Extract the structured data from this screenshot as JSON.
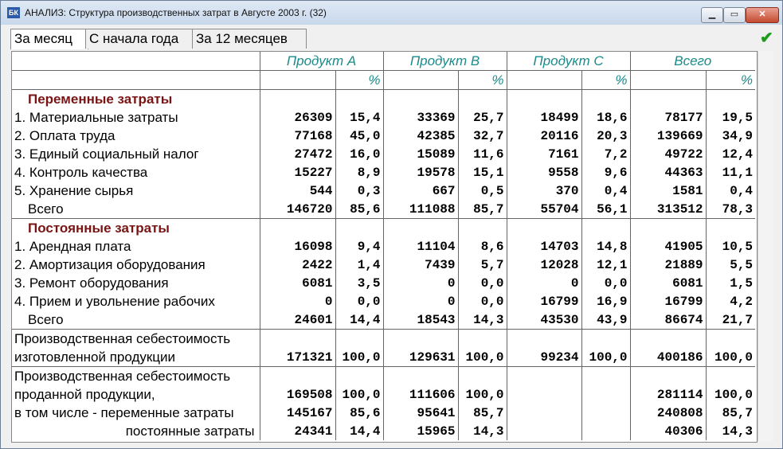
{
  "window": {
    "title": "АНАЛИЗ: Структура производственных затрат в Августе 2003 г. (32)",
    "icon_text": "БК",
    "min_label": "▁",
    "max_label": "▭",
    "close_label": "✕"
  },
  "tabs": [
    "За месяц",
    "С начала года",
    "За 12 месяцев"
  ],
  "ok_icon": "✔",
  "header": {
    "products": [
      "Продукт A",
      "Продукт B",
      "Продукт C",
      "Всего"
    ],
    "pct": "%"
  },
  "sections": {
    "variable_title": "Переменные затраты",
    "fixed_title": "Постоянные затраты"
  },
  "variable_rows": [
    {
      "label": "1. Материальные затраты",
      "v": [
        "26309",
        "15,4",
        "33369",
        "25,7",
        "18499",
        "18,6",
        "78177",
        "19,5"
      ]
    },
    {
      "label": "2. Оплата труда",
      "v": [
        "77168",
        "45,0",
        "42385",
        "32,7",
        "20116",
        "20,3",
        "139669",
        "34,9"
      ]
    },
    {
      "label": "3. Единый социальный налог",
      "v": [
        "27472",
        "16,0",
        "15089",
        "11,6",
        "7161",
        "7,2",
        "49722",
        "12,4"
      ]
    },
    {
      "label": "4. Контроль качества",
      "v": [
        "15227",
        "8,9",
        "19578",
        "15,1",
        "9558",
        "9,6",
        "44363",
        "11,1"
      ]
    },
    {
      "label": "5. Хранение сырья",
      "v": [
        "544",
        "0,3",
        "667",
        "0,5",
        "370",
        "0,4",
        "1581",
        "0,4"
      ]
    },
    {
      "label": "Всего",
      "v": [
        "146720",
        "85,6",
        "111088",
        "85,7",
        "55704",
        "56,1",
        "313512",
        "78,3"
      ]
    }
  ],
  "fixed_rows": [
    {
      "label": "1. Арендная плата",
      "v": [
        "16098",
        "9,4",
        "11104",
        "8,6",
        "14703",
        "14,8",
        "41905",
        "10,5"
      ]
    },
    {
      "label": "2. Амортизация оборудования",
      "v": [
        "2422",
        "1,4",
        "7439",
        "5,7",
        "12028",
        "12,1",
        "21889",
        "5,5"
      ]
    },
    {
      "label": "3. Ремонт оборудования",
      "v": [
        "6081",
        "3,5",
        "0",
        "0,0",
        "0",
        "0,0",
        "6081",
        "1,5"
      ]
    },
    {
      "label": "4. Прием и увольнение рабочих",
      "v": [
        "0",
        "0,0",
        "0",
        "0,0",
        "16799",
        "16,9",
        "16799",
        "4,2"
      ]
    },
    {
      "label": "Всего",
      "v": [
        "24601",
        "14,4",
        "18543",
        "14,3",
        "43530",
        "43,9",
        "86674",
        "21,7"
      ]
    }
  ],
  "manufactured": {
    "label1": "Производственная себестоимость",
    "label2": "изготовленной продукции",
    "v": [
      "171321",
      "100,0",
      "129631",
      "100,0",
      "99234",
      "100,0",
      "400186",
      "100,0"
    ]
  },
  "sold": {
    "label1": "Производственная себестоимость",
    "rows": [
      {
        "label": "проданной продукции,",
        "v": [
          "169508",
          "100,0",
          "111606",
          "100,0",
          "",
          "",
          "281114",
          "100,0"
        ]
      },
      {
        "label": "в том числе - переменные затраты",
        "v": [
          "145167",
          "85,6",
          "95641",
          "85,7",
          "",
          "",
          "240808",
          "85,7"
        ]
      },
      {
        "label": "постоянные затраты",
        "v": [
          "24341",
          "14,4",
          "15965",
          "14,3",
          "",
          "",
          "40306",
          "14,3"
        ]
      }
    ]
  }
}
